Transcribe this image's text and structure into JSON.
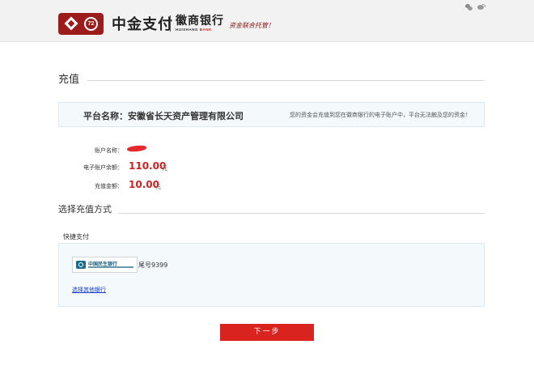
{
  "header": {
    "brand_cn": "中金支付",
    "bank_cn": "徽商银行",
    "bank_en_main": "HUISHANG",
    "bank_en_red": "BANK",
    "slogan": "资金联合托管！",
    "logo_mark": "72"
  },
  "recharge": {
    "section_title": "充值",
    "platform_label": "平台名称：安徽省长天资产管理有限公司",
    "platform_note": "您的资金会充值到您在徽商银行的电子账户中，平台无法触及您的资金！",
    "account_name_label": "账户名称：",
    "balance_label": "电子账户余额：",
    "balance_value": "110.00",
    "balance_unit": "元",
    "amount_label": "充值金额：",
    "amount_value": "10.00",
    "amount_unit": "元"
  },
  "payment": {
    "section_title": "选择充值方式",
    "quick_label": "快捷支付",
    "bank_name": "中国民生银行",
    "tail_number": "尾号9399",
    "other_bank_link": "选择其他银行"
  },
  "actions": {
    "next_label": "下一步"
  },
  "colors": {
    "accent_red": "#d9231f",
    "header_bg": "#f2f2f2",
    "logo_red": "#9c1c1c",
    "link_blue": "#1a3cc8"
  }
}
